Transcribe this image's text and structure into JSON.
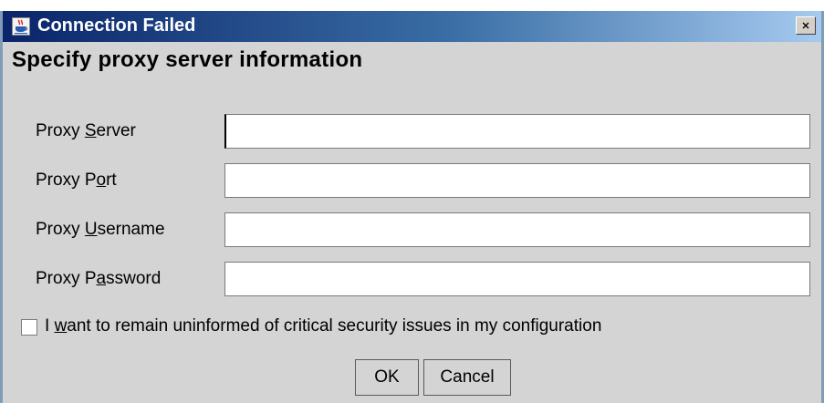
{
  "window": {
    "title": "Connection Failed",
    "close_glyph": "×"
  },
  "dialog": {
    "heading": "Specify proxy server information"
  },
  "fields": [
    {
      "name": "proxy-server",
      "label_pre": "Proxy ",
      "mnemonic": "S",
      "label_post": "erver",
      "value": ""
    },
    {
      "name": "proxy-port",
      "label_pre": "Proxy P",
      "mnemonic": "o",
      "label_post": "rt",
      "value": ""
    },
    {
      "name": "proxy-username",
      "label_pre": "Proxy ",
      "mnemonic": "U",
      "label_post": "sername",
      "value": ""
    },
    {
      "name": "proxy-password",
      "label_pre": "Proxy P",
      "mnemonic": "a",
      "label_post": "ssword",
      "value": ""
    }
  ],
  "checkbox": {
    "label_pre": "I ",
    "mnemonic": "w",
    "label_post": "ant to remain uninformed of critical security issues in my configuration",
    "checked": false
  },
  "buttons": {
    "ok_label": "OK",
    "cancel_label": "Cancel"
  },
  "icons": {
    "title_icon": "java-cup-icon",
    "close_icon": "close-icon"
  }
}
